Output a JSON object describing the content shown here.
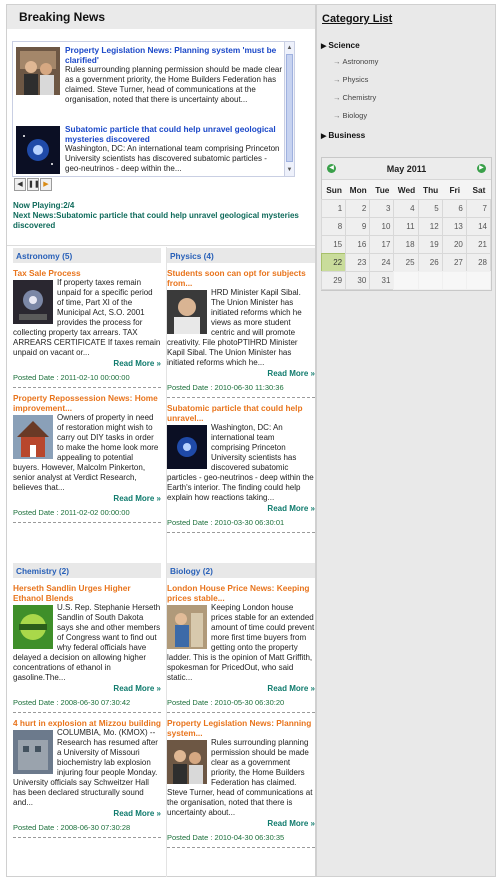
{
  "breaking": {
    "title": "Breaking News",
    "items": [
      {
        "title": "Property Legislation News: Planning system 'must be clarified'",
        "body": "Rules surrounding planning permission should be made clear as a government priority, the Home Builders Federation has claimed. Steve Turner, head of communications at the organisation, noted that there is uncertainty about..."
      },
      {
        "title": "Subatomic particle that could help unravel geological mysteries discovered",
        "body": "Washington, DC: An international team comprising Princeton University scientists has discovered subatomic particles - geo-neutrinos - deep within the..."
      }
    ],
    "now_playing": "Now Playing:2/4",
    "next_news": "Next News:Subatomic particle that could help unravel geological mysteries discovered"
  },
  "categories": [
    {
      "header": "Astronomy (5)",
      "articles": [
        {
          "title": "Tax Sale Process",
          "body": "If property taxes remain unpaid for a specific period of time, Part XI of the Municipal Act, S.O. 2001 provides the process for collecting property tax arrears. TAX ARREARS CERTIFICATE If taxes remain unpaid on vacant or...",
          "read_more": "Read More »",
          "posted": "Posted Date : 2011-02-10 00:00:00"
        },
        {
          "title": "Property Repossession News: Home improvement...",
          "body": "Owners of property in need of restoration might wish to carry out DIY tasks in order to make the home look more appealing to potential buyers. However, Malcolm Pinkerton, senior analyst at Verdict Research, believes that...",
          "read_more": "Read More »",
          "posted": "Posted Date : 2011-02-02 00:00:00"
        }
      ]
    },
    {
      "header": "Physics (4)",
      "articles": [
        {
          "title": "Students soon can opt for subjects from...",
          "body": "HRD Minister Kapil Sibal. The Union Minister has initiated reforms which he views as more student centric and will promote creativity. File photoPTIHRD Minister Kapil Sibal. The Union Minister has initiated reforms which he...",
          "read_more": "Read More »",
          "posted": "Posted Date : 2010-06-30 11:30:36"
        },
        {
          "title": "Subatomic particle that could help unravel...",
          "body": "Washington, DC: An international team comprising Princeton University scientists has discovered subatomic particles - geo-neutrinos - deep within the Earth's interior. The finding could help explain how reactions taking...",
          "read_more": "Read More »",
          "posted": "Posted Date : 2010-03-30 06:30:01"
        }
      ]
    },
    {
      "header": "Chemistry (2)",
      "articles": [
        {
          "title": "Herseth Sandlin Urges Higher Ethanol Blends",
          "body": "U.S. Rep. Stephanie Herseth Sandlin of South Dakota says she and other members of Congress want to find out why federal officials have delayed a decision on allowing higher concentrations of ethanol in gasoline.The...",
          "read_more": "Read More »",
          "posted": "Posted Date : 2008-06-30 07:30:42"
        },
        {
          "title": "4 hurt in explosion at Mizzou building",
          "body": "COLUMBIA, Mo. (KMOX) -- Research has resumed after a University of Missouri biochemistry lab explosion injuring four people Monday. University officials say Schweitzer Hall has been declared structurally sound and...",
          "read_more": "Read More »",
          "posted": "Posted Date : 2008-06-30 07:30:28"
        }
      ]
    },
    {
      "header": "Biology (2)",
      "articles": [
        {
          "title": "London House Price News: Keeping prices stable...",
          "body": "Keeping London house prices stable for an extended amount of time could prevent more first time buyers from getting onto the property ladder. This is the opinion of Matt Griffith, spokesman for PricedOut, who said static...",
          "read_more": "Read More »",
          "posted": "Posted Date : 2010-05-30 06:30:20"
        },
        {
          "title": "Property Legislation News: Planning system...",
          "body": "Rules surrounding planning permission should be made clear as a government priority, the Home Builders Federation has claimed. Steve Turner, head of communications at the organisation, noted that there is uncertainty about...",
          "read_more": "Read More »",
          "posted": "Posted Date : 2010-04-30 06:30:35"
        }
      ]
    }
  ],
  "sidebar": {
    "title": "Category List",
    "tree": {
      "science": "Science",
      "astronomy": "Astronomy",
      "physics": "Physics",
      "chemistry": "Chemistry",
      "biology": "Biology",
      "business": "Business"
    },
    "calendar": {
      "month": "May 2011",
      "days_of_week": [
        "Sun",
        "Mon",
        "Tue",
        "Wed",
        "Thu",
        "Fri",
        "Sat"
      ],
      "leading_blanks": 0,
      "days": [
        1,
        2,
        3,
        4,
        5,
        6,
        7,
        8,
        9,
        10,
        11,
        12,
        13,
        14,
        15,
        16,
        17,
        18,
        19,
        20,
        21,
        22,
        23,
        24,
        25,
        26,
        27,
        28,
        29,
        30,
        31
      ],
      "today": 22
    }
  },
  "colors": {
    "link_blue": "#1b48c8",
    "article_orange": "#e8741c",
    "category_blue": "#2860b8",
    "teal": "#0e7a6c",
    "posted_green": "#1b6f3a",
    "today_green": "#c9dc9b"
  }
}
